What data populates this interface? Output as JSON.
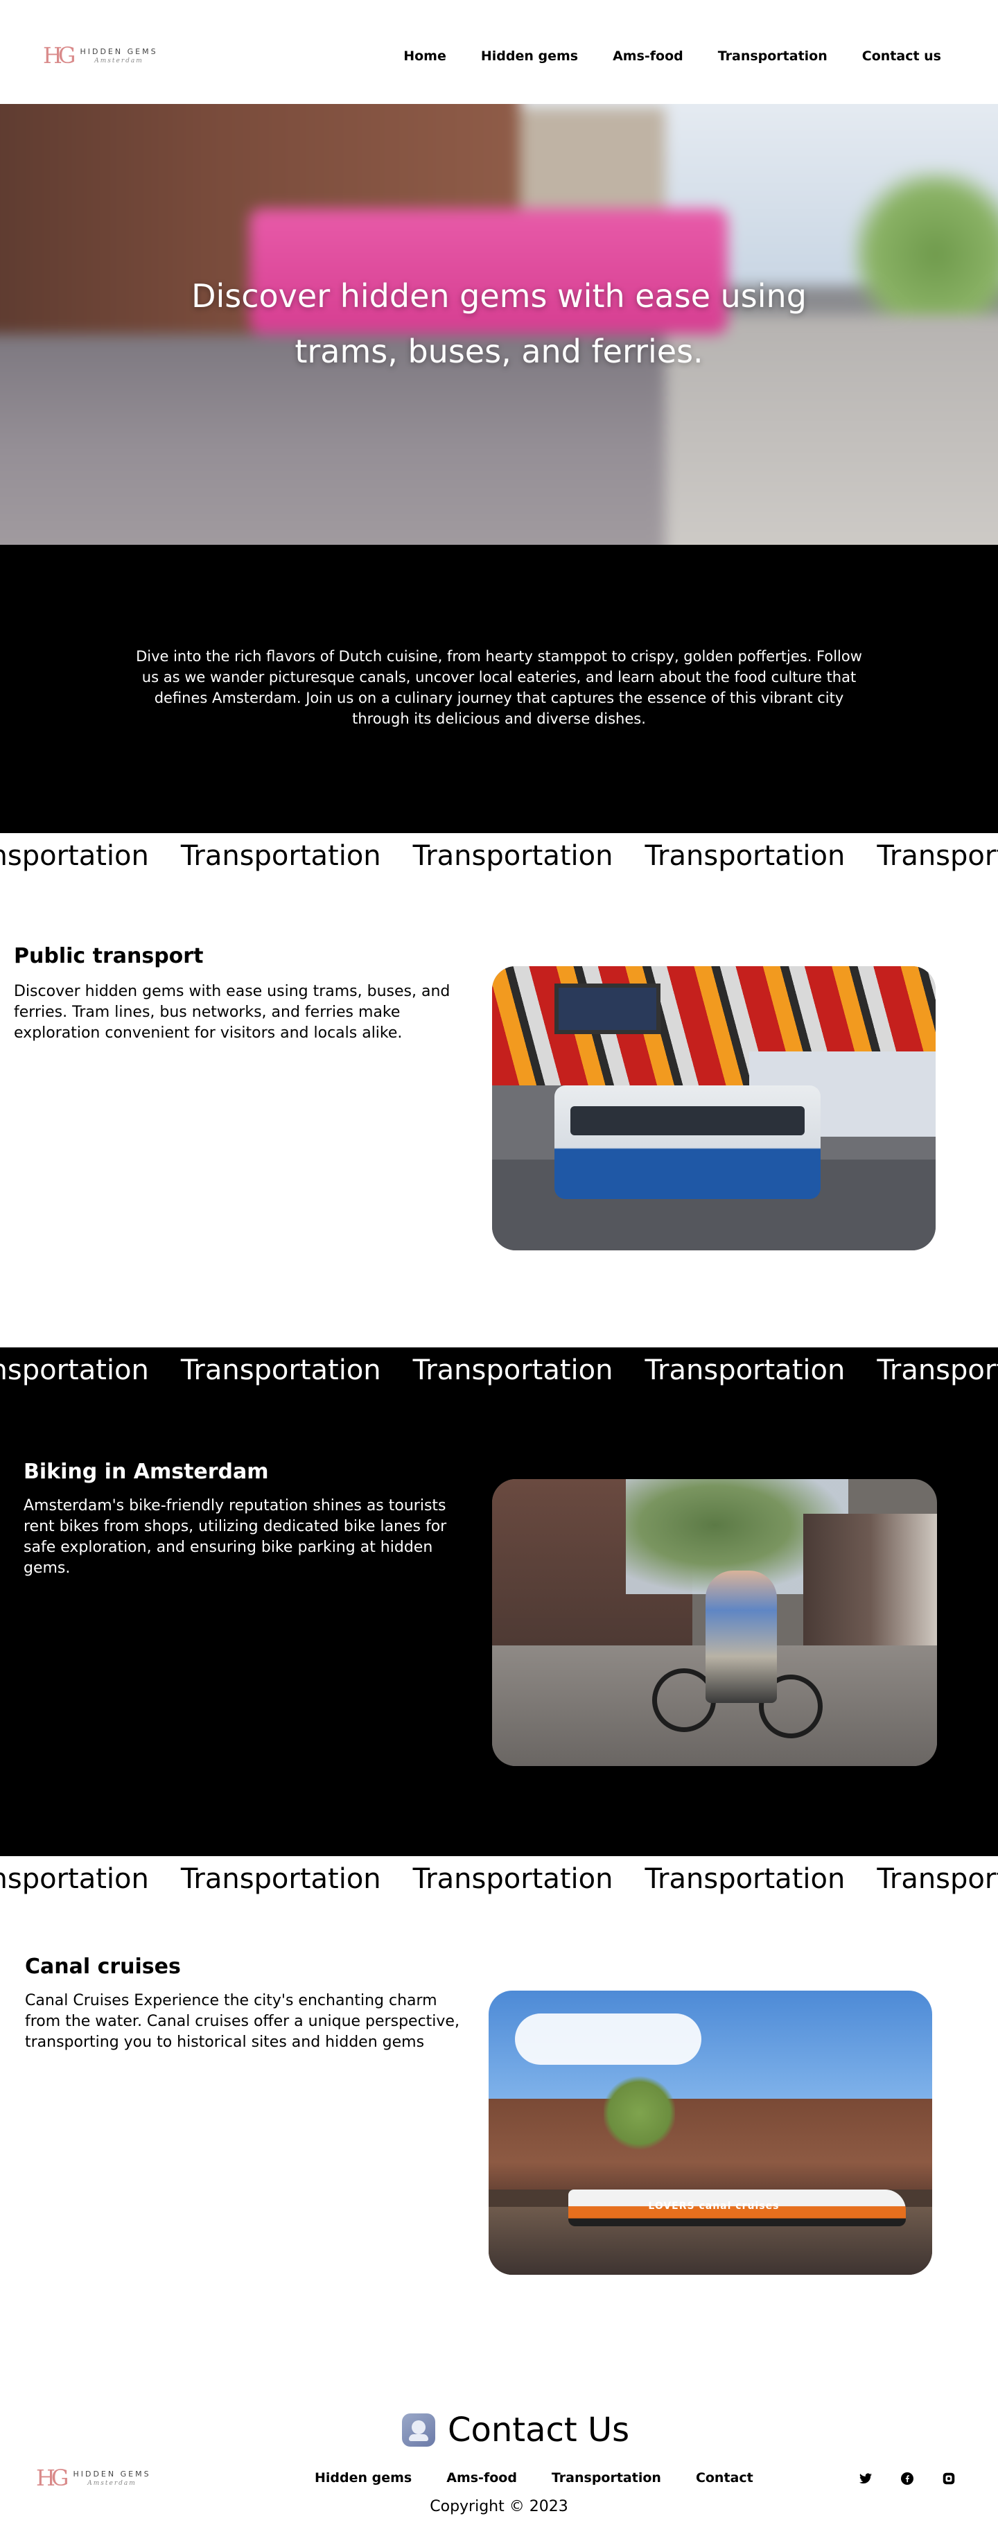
{
  "brand": {
    "mark": "HG",
    "title": "HIDDEN GEMS",
    "subtitle": "Amsterdam"
  },
  "nav": {
    "items": [
      "Home",
      "Hidden gems",
      "Ams-food",
      "Transportation",
      "Contact us"
    ]
  },
  "hero": {
    "title": "Discover hidden gems with ease using trams, buses, and ferries."
  },
  "intro": {
    "text": "Dive into the rich flavors of Dutch cuisine, from hearty stamppot to crispy, golden poffertjes. Follow us as we wander picturesque canals, uncover local eateries, and learn about the food culture that defines Amsterdam. Join us on a culinary journey that captures the essence of this vibrant city through its delicious and diverse dishes."
  },
  "marquee": {
    "word": "Transportation"
  },
  "sections": {
    "public": {
      "title": "Public transport",
      "text": "Discover hidden gems with ease using trams, buses, and ferries. Tram lines,  bus networks, and ferries make exploration convenient for visitors and locals alike."
    },
    "biking": {
      "title": "Biking in Amsterdam",
      "text": "Amsterdam's bike-friendly reputation shines as tourists rent bikes from  shops, utilizing dedicated bike lanes for safe exploration, and ensuring bike parking at hidden gems."
    },
    "canal": {
      "title": "Canal cruises",
      "text": "Canal Cruises Experience the city's enchanting charm from the water. Canal cruises offer a unique perspective, transporting you to historical sites and hidden gems",
      "boat_label": "LOVERS canal cruises"
    }
  },
  "footer": {
    "contact_title": "Contact Us",
    "links": [
      "Hidden gems",
      "Ams-food",
      "Transportation",
      "Contact"
    ],
    "social_icons": [
      "twitter-icon",
      "facebook-icon",
      "instagram-icon"
    ],
    "copyright": "Copyright © 2023"
  }
}
